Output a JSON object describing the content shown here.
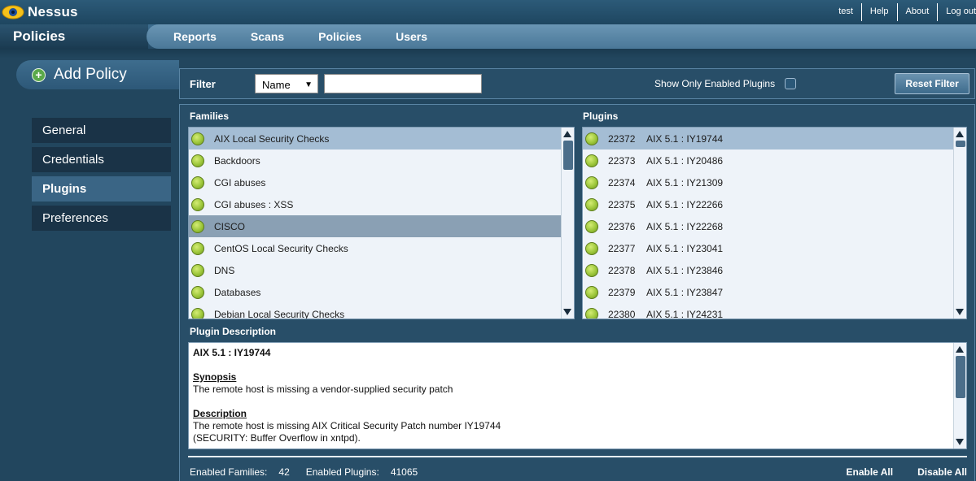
{
  "app": {
    "name": "Nessus",
    "logo_icon": "eye-icon"
  },
  "toplinks": [
    "test",
    "Help",
    "About",
    "Log out"
  ],
  "section_title": "Policies",
  "nav": [
    "Reports",
    "Scans",
    "Policies",
    "Users"
  ],
  "add_policy": {
    "label": "Add Policy",
    "icon": "plus-circle-icon"
  },
  "side_tabs": [
    "General",
    "Credentials",
    "Plugins",
    "Preferences"
  ],
  "active_side_tab": "Plugins",
  "filter": {
    "label": "Filter",
    "select_value": "Name",
    "input_value": "",
    "show_enabled_label": "Show Only Enabled Plugins",
    "reset_label": "Reset Filter"
  },
  "families": {
    "header": "Families",
    "items": [
      "AIX Local Security Checks",
      "Backdoors",
      "CGI abuses",
      "CGI abuses : XSS",
      "CISCO",
      "CentOS Local Security Checks",
      "DNS",
      "Databases",
      "Debian Local Security Checks"
    ],
    "selected_index": 0,
    "highlight_index": 4
  },
  "plugins": {
    "header": "Plugins",
    "items": [
      {
        "id": "22372",
        "name": "AIX 5.1 : IY19744"
      },
      {
        "id": "22373",
        "name": "AIX 5.1 : IY20486"
      },
      {
        "id": "22374",
        "name": "AIX 5.1 : IY21309"
      },
      {
        "id": "22375",
        "name": "AIX 5.1 : IY22266"
      },
      {
        "id": "22376",
        "name": "AIX 5.1 : IY22268"
      },
      {
        "id": "22377",
        "name": "AIX 5.1 : IY23041"
      },
      {
        "id": "22378",
        "name": "AIX 5.1 : IY23846"
      },
      {
        "id": "22379",
        "name": "AIX 5.1 : IY23847"
      },
      {
        "id": "22380",
        "name": "AIX 5.1 : IY24231"
      }
    ],
    "selected_index": 0
  },
  "description": {
    "header": "Plugin Description",
    "title": "AIX 5.1 : IY19744",
    "synopsis_label": "Synopsis",
    "synopsis": "The remote host is missing a vendor-supplied security patch",
    "description_label": "Description",
    "description_lines": [
      "The remote host is missing AIX Critical Security Patch number IY19744",
      "(SECURITY: Buffer Overflow in xntpd)."
    ]
  },
  "footer": {
    "enabled_families_label": "Enabled Families:",
    "enabled_families": "42",
    "enabled_plugins_label": "Enabled Plugins:",
    "enabled_plugins": "41065",
    "enable_all": "Enable All",
    "disable_all": "Disable All"
  },
  "colors": {
    "background": "#22465e",
    "status_enabled": "#9cc63a",
    "selected_row": "#a4bdd4"
  }
}
